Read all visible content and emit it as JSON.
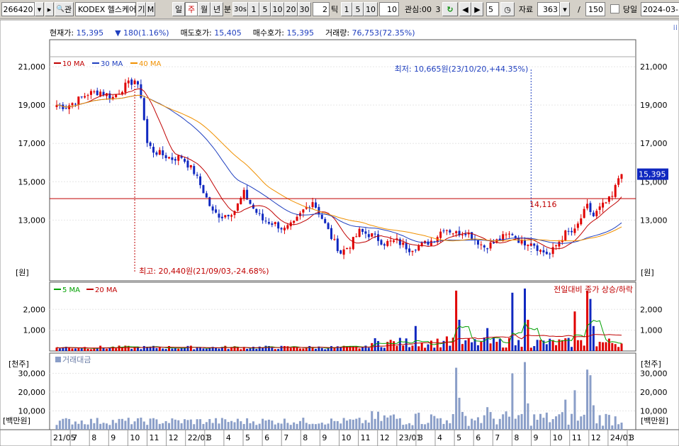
{
  "toolbar": {
    "code": "266420",
    "name": "KODEX 헬스케어",
    "search_icon": "🔍",
    "search_label": "관",
    "chart_mode_g": "기",
    "chart_mode_m": "M",
    "periods": [
      "일",
      "주",
      "월",
      "년",
      "분",
      "30s"
    ],
    "period_selected": "주",
    "minute_options": [
      "1",
      "5",
      "10",
      "20",
      "30"
    ],
    "tick_value": "2",
    "tick_label": "틱",
    "tick_options": [
      "1",
      "5",
      "10"
    ],
    "count_value": "10",
    "interval_label": "관심:00",
    "interval_suffix": "3",
    "step_value": "5",
    "data_label": "자료",
    "data_count": "363",
    "slash": "/",
    "total": "150",
    "today_label": "당일",
    "date": "2024-03-"
  },
  "info": {
    "current_label": "현재가:",
    "current_value": "15,395",
    "change_value": "180(1.16%)",
    "ask_label": "매도호가:",
    "ask_value": "15,405",
    "bid_label": "매수호가:",
    "bid_value": "15,395",
    "volume_label": "거래량:",
    "volume_value": "76,753(72.35%)"
  },
  "price_panel": {
    "legend": [
      {
        "label": "10 MA",
        "color": "#c00000"
      },
      {
        "label": "30 MA",
        "color": "#1f3fbf"
      },
      {
        "label": "40 MA",
        "color": "#f09000"
      }
    ],
    "y_ticks": [
      "21,000",
      "19,000",
      "17,000",
      "15,000",
      "13,000"
    ],
    "y_unit": "[원]",
    "current_price_label": "15,395",
    "hline_label": "14,116",
    "high_annotation": "최고: 20,440원(21/09/03,-24.68%)",
    "low_annotation": "최저: 10,665원(23/10/20,+44.35%)"
  },
  "volume_panel": {
    "legend": [
      {
        "label": "5 MA",
        "color": "#00a000"
      },
      {
        "label": "20 MA",
        "color": "#c00000"
      }
    ],
    "right_label": "전일대비 종가 상승/하락",
    "y_ticks": [
      "2,000",
      "1,000"
    ],
    "y_unit": "[천주]"
  },
  "amount_panel": {
    "legend": [
      {
        "label": "거래대금",
        "color": "#8a9ec8"
      }
    ],
    "y_ticks": [
      "30,000",
      "20,000",
      "10,000"
    ],
    "y_unit": "[백만원]"
  },
  "x_axis": {
    "labels": [
      "21/05",
      "7",
      "8",
      "9",
      "10",
      "11",
      "12",
      "22/01",
      "3",
      "4",
      "5",
      "6",
      "7",
      "8",
      "9",
      "10",
      "11",
      "12",
      "23/01",
      "3",
      "4",
      "5",
      "6",
      "7",
      "8",
      "9",
      "10",
      "11",
      "12",
      "24/01",
      "3"
    ]
  },
  "colors": {
    "up": "#e00000",
    "down": "#1028c0",
    "ma10": "#c00000",
    "ma30": "#1f3fbf",
    "ma40": "#f09000",
    "hline": "#c00000",
    "amount": "#8a9ec8"
  },
  "chart_data": {
    "type": "candlestick",
    "x_unit": "week index",
    "ylim": [
      10200,
      21300
    ],
    "keypoints": [
      [
        0,
        19000
      ],
      [
        3,
        18900
      ],
      [
        7,
        19300
      ],
      [
        10,
        19600
      ],
      [
        14,
        19700
      ],
      [
        18,
        19400
      ],
      [
        22,
        20000
      ],
      [
        25,
        20300
      ],
      [
        27,
        19500
      ],
      [
        29,
        17000
      ],
      [
        31,
        16600
      ],
      [
        34,
        16400
      ],
      [
        37,
        16200
      ],
      [
        40,
        16300
      ],
      [
        44,
        15500
      ],
      [
        47,
        14500
      ],
      [
        50,
        13400
      ],
      [
        53,
        13200
      ],
      [
        57,
        13500
      ],
      [
        60,
        14400
      ],
      [
        63,
        13600
      ],
      [
        66,
        13000
      ],
      [
        70,
        12800
      ],
      [
        73,
        12500
      ],
      [
        76,
        12800
      ],
      [
        79,
        13500
      ],
      [
        82,
        14000
      ],
      [
        85,
        13100
      ],
      [
        88,
        12100
      ],
      [
        91,
        11300
      ],
      [
        94,
        11700
      ],
      [
        97,
        12400
      ],
      [
        101,
        12200
      ],
      [
        105,
        11800
      ],
      [
        109,
        11900
      ],
      [
        113,
        11500
      ],
      [
        117,
        11700
      ],
      [
        121,
        12000
      ],
      [
        124,
        12600
      ],
      [
        128,
        12300
      ],
      [
        131,
        12400
      ],
      [
        134,
        12000
      ],
      [
        137,
        11600
      ],
      [
        140,
        11800
      ],
      [
        143,
        12100
      ],
      [
        146,
        12300
      ],
      [
        149,
        11800
      ],
      [
        152,
        11900
      ],
      [
        155,
        11400
      ],
      [
        158,
        11200
      ],
      [
        161,
        11900
      ],
      [
        163,
        12300
      ],
      [
        166,
        12400
      ],
      [
        168,
        13100
      ],
      [
        170,
        13700
      ],
      [
        172,
        13200
      ],
      [
        174,
        13600
      ],
      [
        176,
        13900
      ],
      [
        178,
        14200
      ],
      [
        180,
        15200
      ],
      [
        181,
        15395
      ]
    ],
    "volume_spikes": {
      "115": 1200,
      "125": 700,
      "128": 2900,
      "129": 1500,
      "138": 1100,
      "146": 2800,
      "150": 3000,
      "151": 1500,
      "166": 1900,
      "170": 2900,
      "171": 2500,
      "172": 1200
    },
    "amount_spikes": {
      "115": 8500,
      "125": 5000,
      "128": 33000,
      "129": 17000,
      "138": 12000,
      "146": 30000,
      "150": 36000,
      "151": 14000,
      "163": 16000,
      "166": 21000,
      "170": 32000,
      "171": 29000,
      "172": 13000
    }
  }
}
